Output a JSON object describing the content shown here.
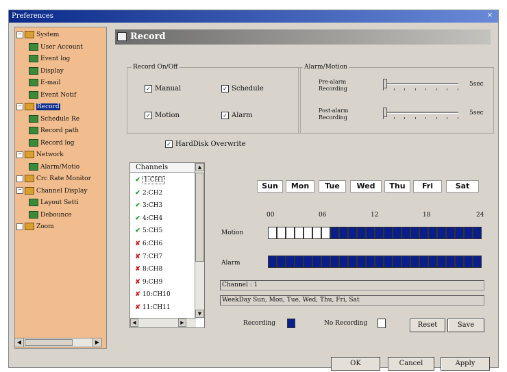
{
  "window": {
    "title": "Preferences",
    "close_glyph": "×"
  },
  "tree": [
    {
      "label": "System",
      "level": 0,
      "exp": "−",
      "icon": "folder-icon"
    },
    {
      "label": "User Account",
      "level": 1,
      "icon": "page-icon"
    },
    {
      "label": "Event log",
      "level": 1,
      "icon": "page-icon"
    },
    {
      "label": "Display",
      "level": 1,
      "icon": "page-icon"
    },
    {
      "label": "E-mail",
      "level": 1,
      "icon": "page-icon"
    },
    {
      "label": "Event Notif",
      "level": 1,
      "icon": "page-icon"
    },
    {
      "label": "Record",
      "level": 0,
      "exp": "−",
      "icon": "folder-icon",
      "selected": true
    },
    {
      "label": "Schedule Re",
      "level": 1,
      "icon": "page-icon"
    },
    {
      "label": "Record path",
      "level": 1,
      "icon": "page-icon"
    },
    {
      "label": "Record log",
      "level": 1,
      "icon": "page-icon"
    },
    {
      "label": "Network",
      "level": 0,
      "exp": "−",
      "icon": "folder-icon"
    },
    {
      "label": "Alarm/Motio",
      "level": 1,
      "icon": "page-icon"
    },
    {
      "label": "Crc Rate Monitor",
      "level": 0,
      "exp": "",
      "icon": "folder-icon"
    },
    {
      "label": "Channel Display",
      "level": 0,
      "exp": "−",
      "icon": "folder-icon"
    },
    {
      "label": "Layout Setti",
      "level": 1,
      "icon": "page-icon"
    },
    {
      "label": "Debounce",
      "level": 1,
      "icon": "page-icon"
    },
    {
      "label": "Zoom",
      "level": 0,
      "exp": "",
      "icon": "folder-icon"
    }
  ],
  "panel": {
    "title": "Record"
  },
  "record_onoff": {
    "legend": "Record On/Off",
    "manual": "Manual",
    "schedule": "Schedule",
    "motion": "Motion",
    "alarm": "Alarm",
    "checked_glyph": "✓"
  },
  "alarm_motion": {
    "legend": "Alarm/Motion",
    "pre_label": "Pre-alarm Recording",
    "post_label": "Post-alarm Recording",
    "pre_value": "5sec",
    "post_value": "5sec",
    "pre_level": 0.0,
    "post_level": 0.0
  },
  "overwrite": "HardDisk Overwrite",
  "channels": {
    "header": "Channels",
    "items": [
      {
        "name": "1:CH1",
        "on": true,
        "selected": true
      },
      {
        "name": "2:CH2",
        "on": true
      },
      {
        "name": "3:CH3",
        "on": true
      },
      {
        "name": "4:CH4",
        "on": true
      },
      {
        "name": "5:CH5",
        "on": true
      },
      {
        "name": "6:CH6",
        "on": false
      },
      {
        "name": "7:CH7",
        "on": false
      },
      {
        "name": "8:CH8",
        "on": false
      },
      {
        "name": "9:CH9",
        "on": false
      },
      {
        "name": "10:CH10",
        "on": false
      },
      {
        "name": "11:CH11",
        "on": false
      }
    ],
    "ok_glyph": "✔",
    "no_glyph": "✘"
  },
  "days": [
    "Sun",
    "Mon",
    "Tue",
    "Wed",
    "Thu",
    "Fri",
    "Sat"
  ],
  "hours": [
    "00",
    "06",
    "12",
    "18",
    "24"
  ],
  "motion_label": "Motion",
  "alarm_label": "Alarm",
  "motion_cells_off": 7,
  "total_cells": 24,
  "channel_info": "Channel : 1",
  "weekday_info": "WeekDay Sun, Mon, Tue, Wed, Thu, Fri, Sat",
  "legend_recording": "Recording",
  "legend_no_recording": "No Recording",
  "reset_label": "Reset",
  "save_label": "Save",
  "ok_label": "OK",
  "cancel_label": "Cancel",
  "apply_label": "Apply",
  "colors": {
    "record_on": "#0a1e8a",
    "tree_bg": "#f2bd8e"
  }
}
